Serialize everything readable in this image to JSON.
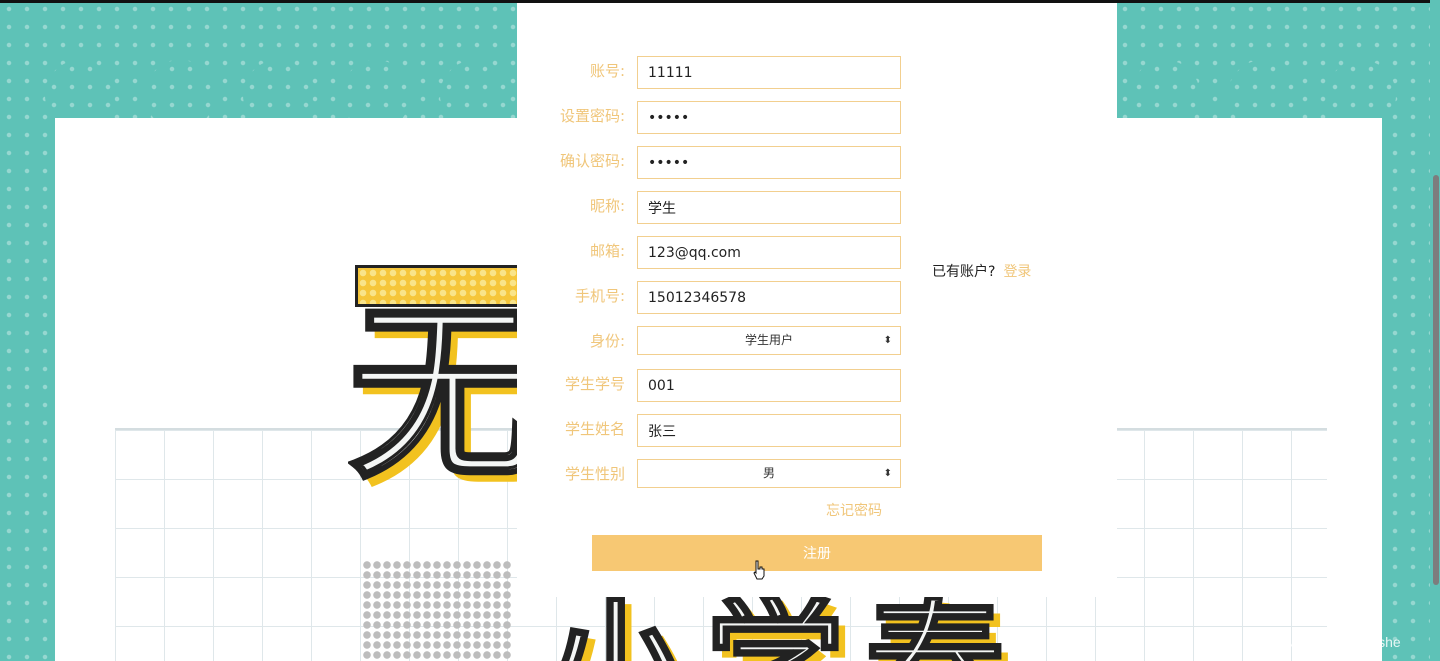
{
  "form": {
    "account": {
      "label": "账号:",
      "value": "11111"
    },
    "password": {
      "label": "设置密码:",
      "value": "•••••"
    },
    "confirm_password": {
      "label": "确认密码:",
      "value": "•••••"
    },
    "nickname": {
      "label": "昵称:",
      "value": "学生"
    },
    "email": {
      "label": "邮箱:",
      "value": "123@qq.com"
    },
    "phone": {
      "label": "手机号:",
      "value": "15012346578"
    },
    "identity": {
      "label": "身份:",
      "value": "学生用户"
    },
    "student_no": {
      "label": "学生学号",
      "value": "001"
    },
    "student_name": {
      "label": "学生姓名",
      "value": "张三"
    },
    "student_gender": {
      "label": "学生性别",
      "value": "男"
    },
    "forgot_label": "忘记密码",
    "register_label": "注册"
  },
  "side": {
    "has_account_text": "已有账户?",
    "login_label": "登录"
  },
  "watermark": "CSDN @wxin_VXbishe",
  "poster": {
    "top_char": "无",
    "bottom_chars": "小学春"
  },
  "colors": {
    "accent": "#f7c873",
    "label": "#f0c67a",
    "background": "#5ec2b7"
  }
}
